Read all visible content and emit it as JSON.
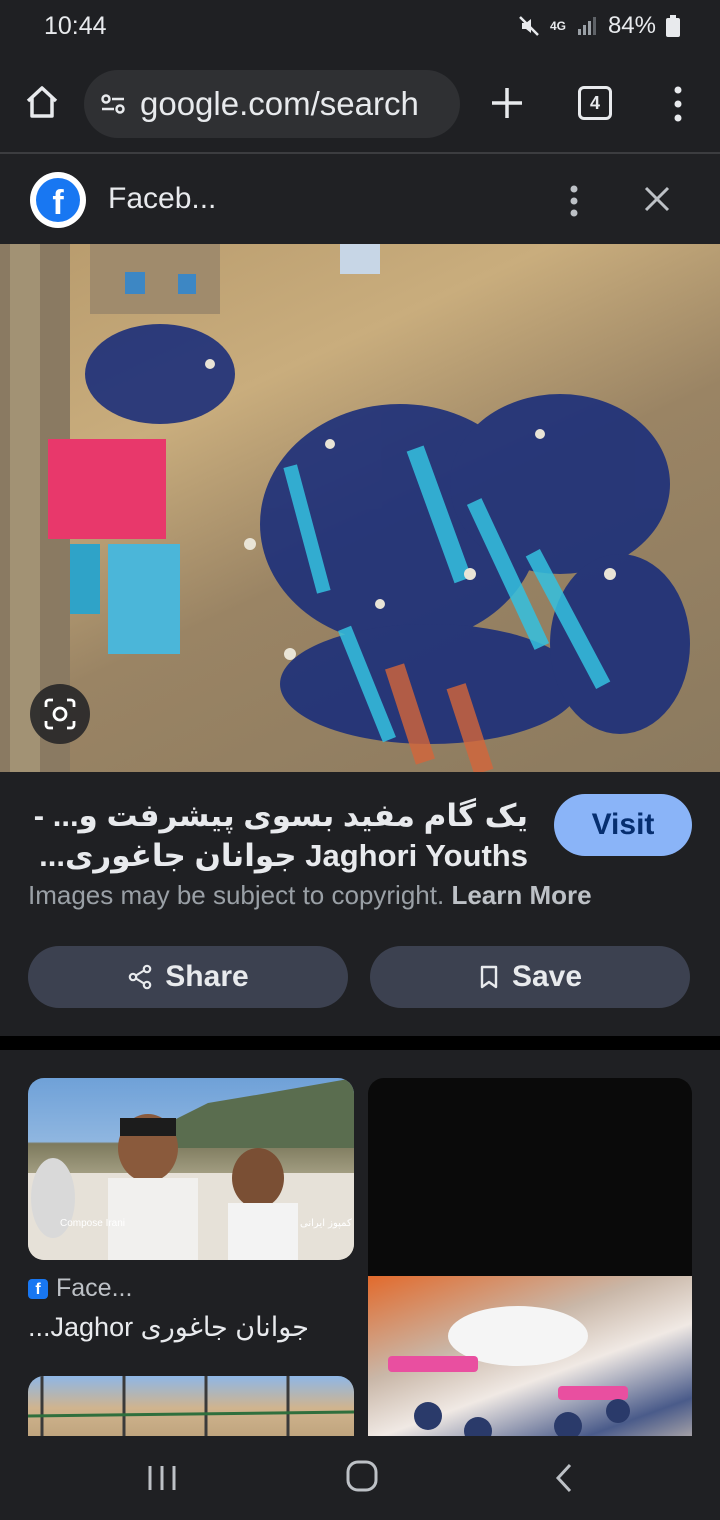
{
  "status_bar": {
    "time": "10:44",
    "battery": "84%",
    "network": "4G"
  },
  "browser": {
    "url": "google.com/search",
    "tab_count": "4"
  },
  "panel": {
    "source": "Faceb...",
    "title_line1": "یک گام مفید بسوی پیشرفت و... -",
    "title_line2": "Jaghori Youths جوانان جاغوری...",
    "visit_label": "Visit",
    "copyright": "Images may be subject to copyright.",
    "learn_more": "Learn More",
    "share_label": "Share",
    "save_label": "Save"
  },
  "results": [
    {
      "source": "Face...",
      "title": "جوانان جاغوری Jaghor...",
      "caption_left": "Compose Irani",
      "caption_right": "کمپوز ایرانی"
    }
  ],
  "colors": {
    "background": "#1f2023",
    "accent": "#8ab4f8",
    "facebook": "#1877f2"
  }
}
